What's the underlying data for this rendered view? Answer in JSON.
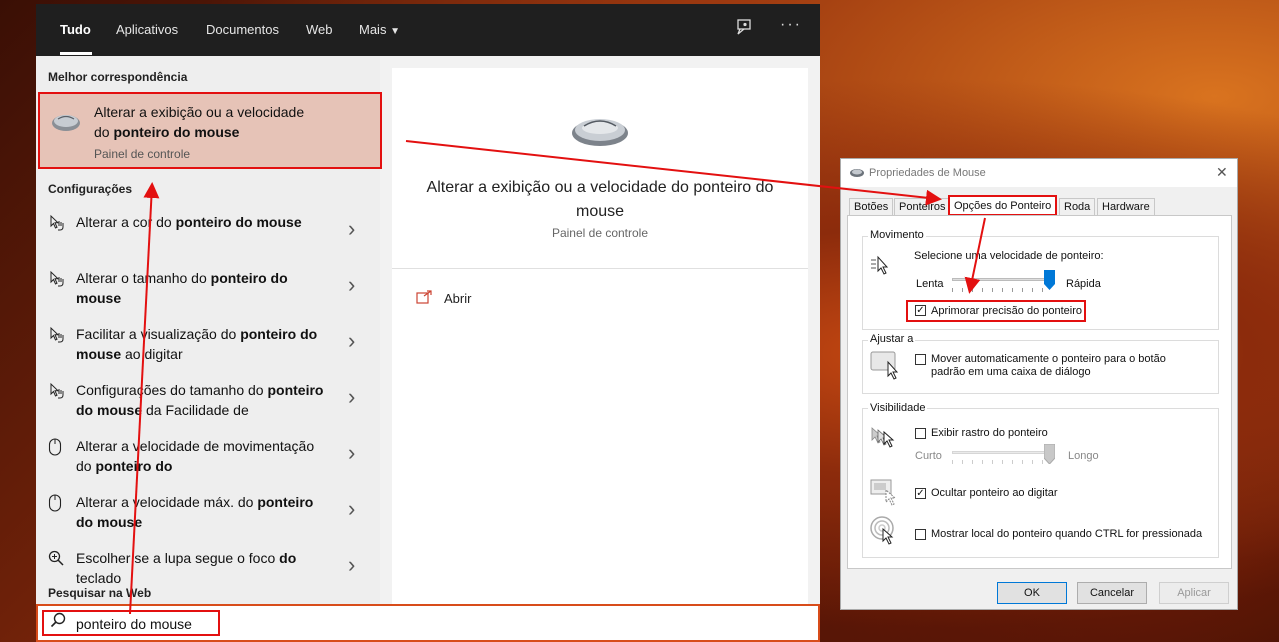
{
  "tabs": [
    "Tudo",
    "Aplicativos",
    "Documentos",
    "Web",
    "Mais"
  ],
  "sections": {
    "best_match": "Melhor correspondência",
    "settings": "Configurações",
    "web": "Pesquisar na Web"
  },
  "best_match": {
    "line1": "Alterar a exibição ou a velocidade",
    "line2_pre": "do ",
    "line2_bold": "ponteiro do mouse",
    "subtitle": "Painel de controle"
  },
  "settings_items": [
    {
      "icon": "pointer-hand-icon",
      "parts": [
        [
          "Alterar a cor do ",
          false
        ],
        [
          "ponteiro do mouse",
          true
        ]
      ]
    },
    {
      "icon": "pointer-hand-icon",
      "parts": [
        [
          "Alterar o tamanho do ",
          false
        ],
        [
          "ponteiro do mouse",
          true
        ]
      ]
    },
    {
      "icon": "pointer-hand-icon",
      "parts": [
        [
          "Facilitar a visualização do ",
          false
        ],
        [
          "ponteiro do mouse",
          true
        ],
        [
          " ao digitar",
          false
        ]
      ]
    },
    {
      "icon": "pointer-hand-icon",
      "parts": [
        [
          "Configurações do tamanho do ",
          false
        ],
        [
          "ponteiro do mouse",
          true
        ],
        [
          " da Facilidade de",
          false
        ]
      ]
    },
    {
      "icon": "mouse-icon",
      "parts": [
        [
          "Alterar a velocidade de movimentação do ",
          false
        ],
        [
          "ponteiro do",
          true
        ]
      ]
    },
    {
      "icon": "mouse-icon",
      "parts": [
        [
          "Alterar a velocidade máx. do ",
          false
        ],
        [
          "ponteiro do mouse",
          true
        ]
      ]
    },
    {
      "icon": "magnifier-icon",
      "parts": [
        [
          "Escolher se a lupa segue o foco ",
          false
        ],
        [
          "do",
          true
        ],
        [
          " teclado",
          false
        ]
      ]
    }
  ],
  "preview": {
    "title": "Alterar a exibição ou a velocidade do ponteiro do mouse",
    "subtitle": "Painel de controle",
    "open_label": "Abrir"
  },
  "search": {
    "query": "ponteiro do mouse"
  },
  "dialog": {
    "title": "Propriedades de Mouse",
    "tabs": [
      "Botões",
      "Ponteiros",
      "Opções do Ponteiro",
      "Roda",
      "Hardware"
    ],
    "motion": {
      "group": "Movimento",
      "label": "Selecione uma velocidade de ponteiro:",
      "slow": "Lenta",
      "fast": "Rápida",
      "speed_level": 1.0,
      "precision_label": "Aprimorar precisão do ponteiro",
      "precision_checked": true
    },
    "snap": {
      "group": "Ajustar a",
      "label_line1": "Mover automaticamente o ponteiro para o botão",
      "label_line2": "padrão em uma caixa de diálogo",
      "checked": false
    },
    "visibility": {
      "group": "Visibilidade",
      "trails_label": "Exibir rastro do ponteiro",
      "trails_checked": false,
      "short": "Curto",
      "long": "Longo",
      "hide_label": "Ocultar ponteiro ao digitar",
      "hide_checked": true,
      "ctrl_label": "Mostrar local do ponteiro quando CTRL for pressionada",
      "ctrl_checked": false
    },
    "buttons": {
      "ok": "OK",
      "cancel": "Cancelar",
      "apply": "Aplicar"
    }
  },
  "colors": {
    "highlight": "#e31010",
    "taskbar": "#1f1f1f",
    "accent": "#0078d7"
  }
}
